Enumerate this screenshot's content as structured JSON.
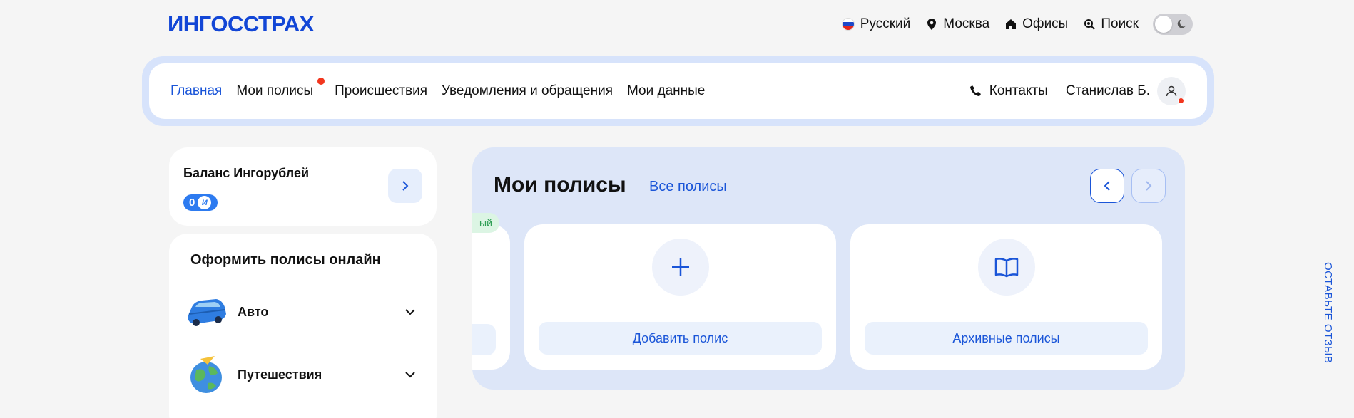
{
  "logo": "ИНГОССТРАХ",
  "topbar": {
    "language": "Русский",
    "city": "Москва",
    "offices": "Офисы",
    "search": "Поиск"
  },
  "nav": {
    "items": [
      {
        "label": "Главная",
        "active": true
      },
      {
        "label": "Мои полисы",
        "badge": true
      },
      {
        "label": "Происшествия"
      },
      {
        "label": "Уведомления и обращения"
      },
      {
        "label": "Мои данные"
      }
    ],
    "contacts": "Контакты",
    "user": "Станислав Б."
  },
  "balance": {
    "title": "Баланс Ингорублей",
    "value": "0",
    "coin_symbol": "И"
  },
  "online": {
    "title": "Оформить полисы онлайн",
    "products": [
      {
        "label": "Авто",
        "icon": "car-icon"
      },
      {
        "label": "Путешествия",
        "icon": "globe-icon"
      }
    ]
  },
  "policies": {
    "title": "Мои полисы",
    "all_link": "Все полисы",
    "partial_tag": "ый",
    "add_label": "Добавить полис",
    "archive_label": "Архивные полисы"
  },
  "feedback": "ОСТАВЬТЕ ОТЗЫВ",
  "colors": {
    "accent": "#1a55d8",
    "nav_frame": "#d7e3fb",
    "policies_bg": "#dde6f8",
    "badge_red": "#f2361e"
  }
}
